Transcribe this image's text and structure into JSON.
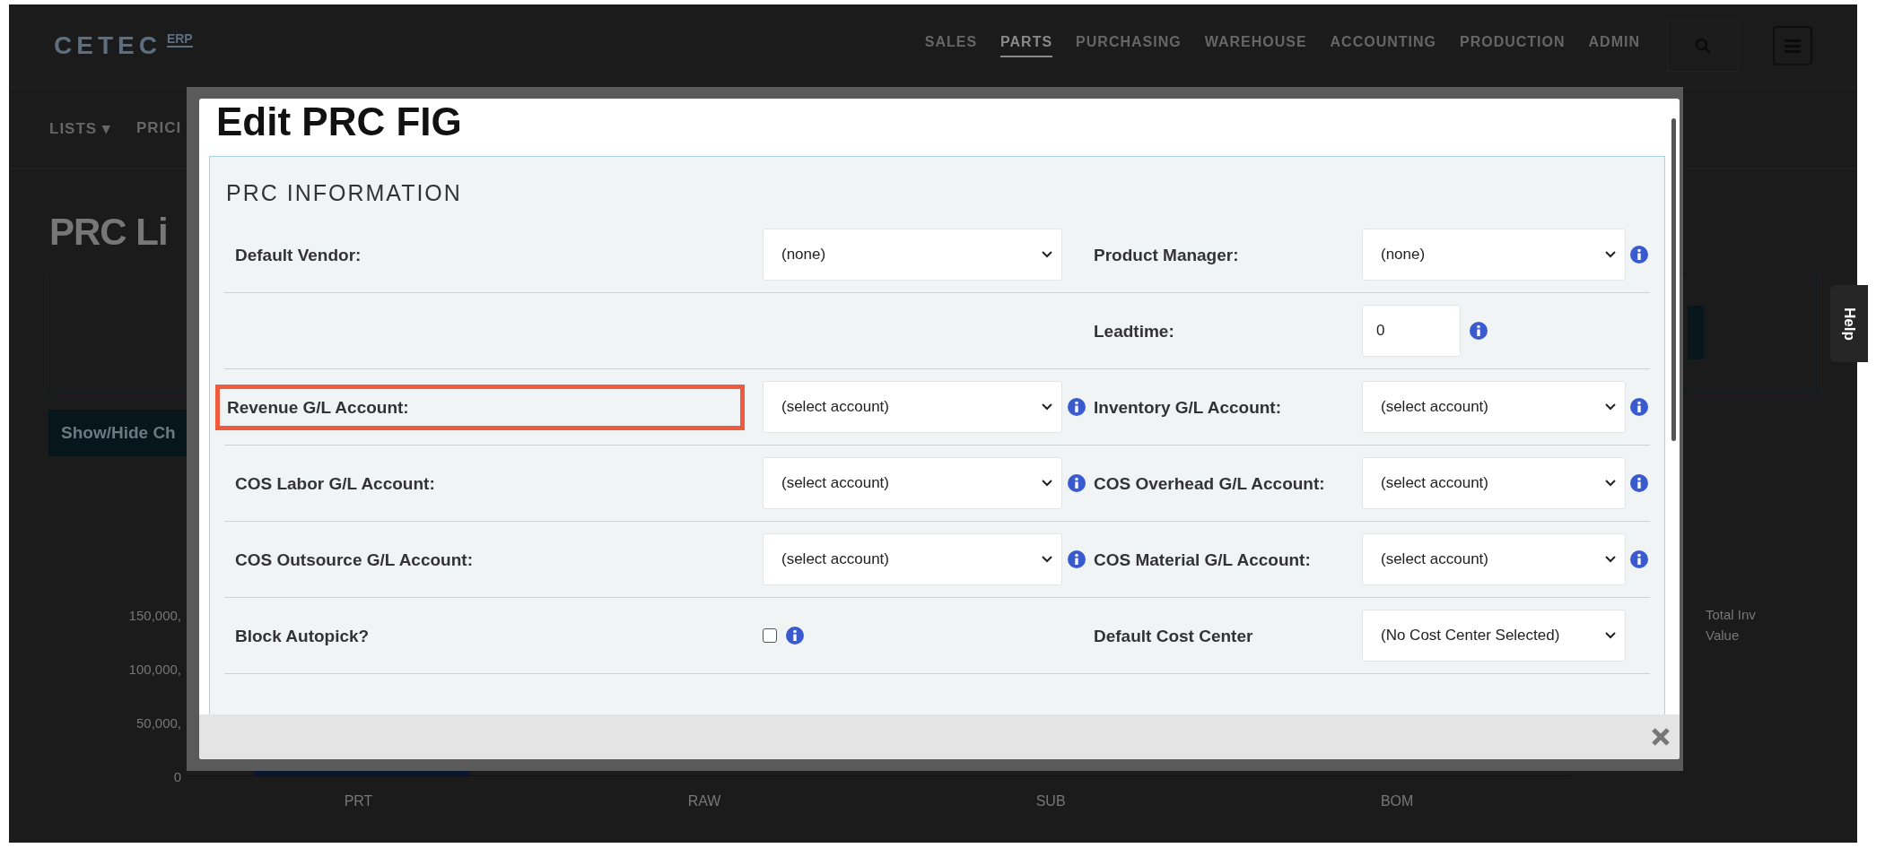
{
  "header": {
    "logo": "CETEC",
    "logo_tag": "ERP",
    "nav": [
      {
        "label": "SALES",
        "selected": false
      },
      {
        "label": "PARTS",
        "selected": true
      },
      {
        "label": "PURCHASING",
        "selected": false
      },
      {
        "label": "WAREHOUSE",
        "selected": false
      },
      {
        "label": "ACCOUNTING",
        "selected": false
      },
      {
        "label": "PRODUCTION",
        "selected": false
      },
      {
        "label": "ADMIN",
        "selected": false
      }
    ]
  },
  "subnav": [
    "LISTS ▾",
    "PRICI"
  ],
  "page_title": "PRC Li",
  "toggle_button": "Show/Hide Ch",
  "chart": {
    "y_labels": [
      "150,000,",
      "100,000,",
      "50,000,",
      "0"
    ],
    "x_labels": [
      "PRT",
      "RAW",
      "SUB",
      "BOM"
    ],
    "legend": [
      "Total Inv",
      "Value"
    ]
  },
  "help_tab": "Help",
  "modal": {
    "title": "Edit PRC FIG",
    "section_title": "PRC INFORMATION",
    "rows": [
      {
        "left": {
          "label": "Default Vendor:",
          "highlighted": false,
          "control": {
            "kind": "select",
            "value": "(none)"
          },
          "info": false
        },
        "right": {
          "label": "Product Manager:",
          "control": {
            "kind": "select",
            "value": "(none)"
          },
          "info": true
        }
      },
      {
        "right": {
          "label": "Leadtime:",
          "control": {
            "kind": "input",
            "value": "0"
          },
          "info": true
        }
      },
      {
        "left": {
          "label": "Revenue G/L Account:",
          "highlighted": true,
          "control": {
            "kind": "select",
            "value": "(select account)"
          },
          "info": true
        },
        "right": {
          "label": "Inventory G/L Account:",
          "control": {
            "kind": "select",
            "value": "(select account)"
          },
          "info": true
        }
      },
      {
        "left": {
          "label": "COS Labor G/L Account:",
          "highlighted": false,
          "control": {
            "kind": "select",
            "value": "(select account)"
          },
          "info": true
        },
        "right": {
          "label": "COS Overhead G/L Account:",
          "control": {
            "kind": "select",
            "value": "(select account)"
          },
          "info": true
        }
      },
      {
        "left": {
          "label": "COS Outsource G/L Account:",
          "highlighted": false,
          "control": {
            "kind": "select",
            "value": "(select account)"
          },
          "info": true
        },
        "right": {
          "label": "COS Material G/L Account:",
          "control": {
            "kind": "select",
            "value": "(select account)"
          },
          "info": true
        }
      },
      {
        "left": {
          "label": "Block Autopick?",
          "highlighted": false,
          "control": {
            "kind": "checkbox",
            "checked": false
          },
          "info": true
        },
        "right": {
          "label": "Default Cost Center",
          "control": {
            "kind": "select",
            "value": "(No Cost Center Selected)"
          },
          "info": false
        }
      }
    ]
  }
}
